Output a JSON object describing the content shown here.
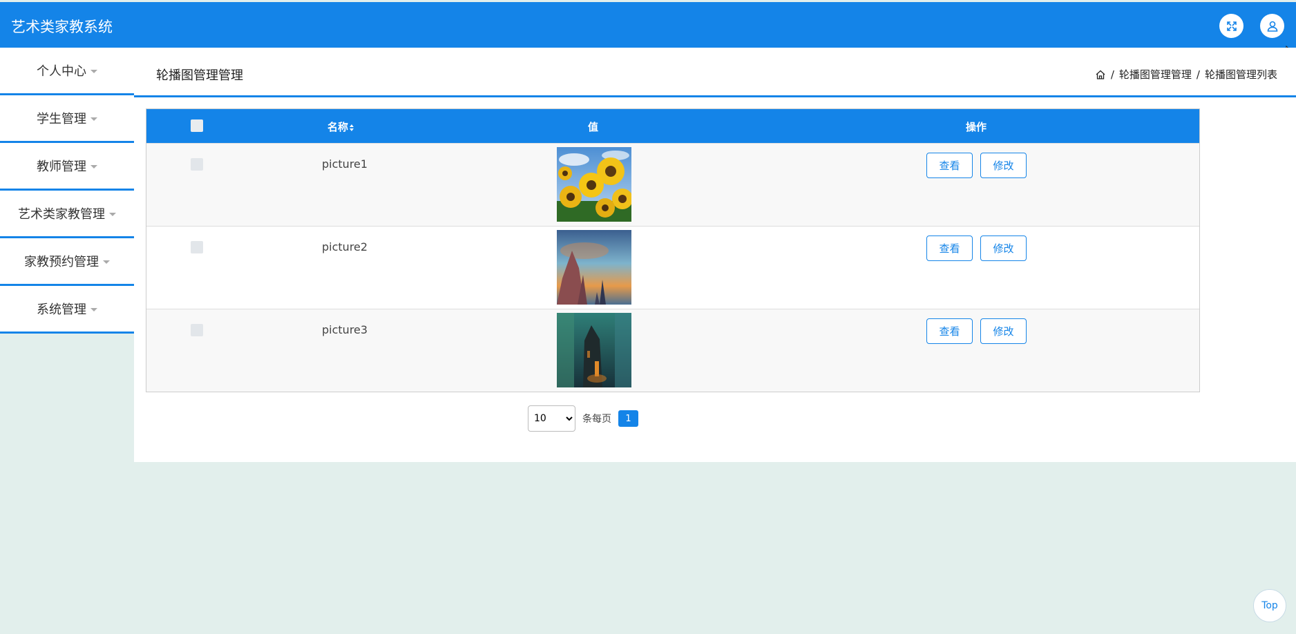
{
  "app": {
    "title": "艺术类家教系统"
  },
  "topbar": {
    "fullscreen_icon": "expand-icon",
    "user_icon": "user-icon"
  },
  "sidebar": {
    "items": [
      {
        "label": "个人中心"
      },
      {
        "label": "学生管理"
      },
      {
        "label": "教师管理"
      },
      {
        "label": "艺术类家教管理"
      },
      {
        "label": "家教预约管理"
      },
      {
        "label": "系统管理"
      }
    ]
  },
  "page": {
    "title": "轮播图管理管理",
    "breadcrumb": {
      "home_icon": "home-icon",
      "level1": "轮播图管理管理",
      "level2": "轮播图管理列表",
      "sep": "/"
    }
  },
  "table": {
    "headers": {
      "name": "名称",
      "value": "值",
      "actions": "操作"
    },
    "rows": [
      {
        "name": "picture1",
        "image": "sunflowers"
      },
      {
        "name": "picture2",
        "image": "rock-spires-sunset"
      },
      {
        "name": "picture3",
        "image": "dark-tower-teal"
      }
    ],
    "view_label": "查看",
    "edit_label": "修改"
  },
  "pagination": {
    "page_size": "10",
    "per_page_label": "条每页",
    "current_page": "1"
  },
  "float": {
    "top_label": "Top"
  },
  "colors": {
    "primary": "#1484e8",
    "background": "#e2efec"
  }
}
